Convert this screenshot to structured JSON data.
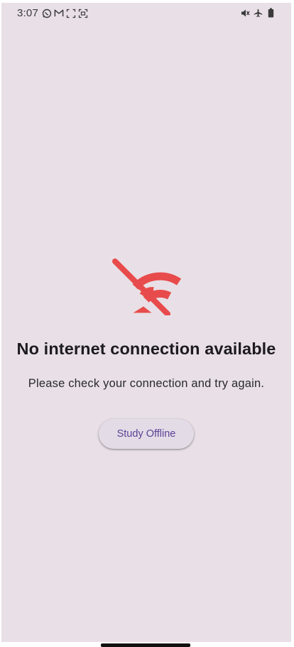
{
  "status_bar": {
    "time": "3:07",
    "left_icons": [
      "whatsapp-icon",
      "gmail-icon",
      "screenshot-frame-icon",
      "screen-record-icon"
    ],
    "right_icons": [
      "mute-icon",
      "airplane-mode-icon",
      "battery-icon"
    ]
  },
  "offline_screen": {
    "icon": "wifi-off-icon",
    "icon_color": "#e84b4b",
    "title": "No internet connection available",
    "message": "Please check your connection and try again.",
    "button_label": "Study Offline"
  },
  "colors": {
    "background": "#e8e0e6",
    "button_text": "#5b4396",
    "button_background": "#e3dbe6",
    "title_text": "#1d1b20"
  }
}
